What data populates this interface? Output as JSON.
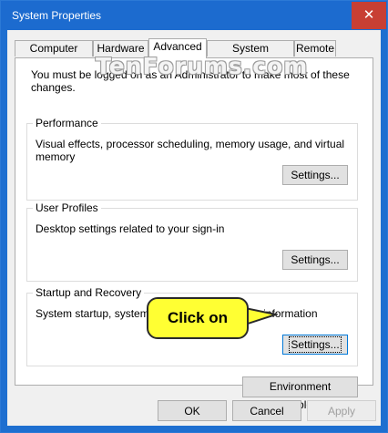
{
  "window": {
    "title": "System Properties",
    "close_glyph": "✕"
  },
  "tabs": [
    {
      "label": "Computer Name",
      "active": false
    },
    {
      "label": "Hardware",
      "active": false
    },
    {
      "label": "Advanced",
      "active": true
    },
    {
      "label": "System Protection",
      "active": false
    },
    {
      "label": "Remote",
      "active": false
    }
  ],
  "advanced": {
    "admin_note": "You must be logged on as an Administrator to make most of these changes.",
    "performance": {
      "title": "Performance",
      "description": "Visual effects, processor scheduling, memory usage, and virtual memory",
      "button": "Settings..."
    },
    "user_profiles": {
      "title": "User Profiles",
      "description": "Desktop settings related to your sign-in",
      "button": "Settings..."
    },
    "startup_recovery": {
      "title": "Startup and Recovery",
      "description": "System startup, system failure, and debugging information",
      "button": "Settings..."
    },
    "env_button": "Environment Variables..."
  },
  "footer": {
    "ok": "OK",
    "cancel": "Cancel",
    "apply": "Apply"
  },
  "watermark": "TenForums.com",
  "callout": {
    "text": "Click on",
    "color": "#ffff33"
  },
  "colors": {
    "titlebar": "#1c6bcf",
    "close": "#c83f34",
    "dialog_bg": "#f0f0f0"
  }
}
